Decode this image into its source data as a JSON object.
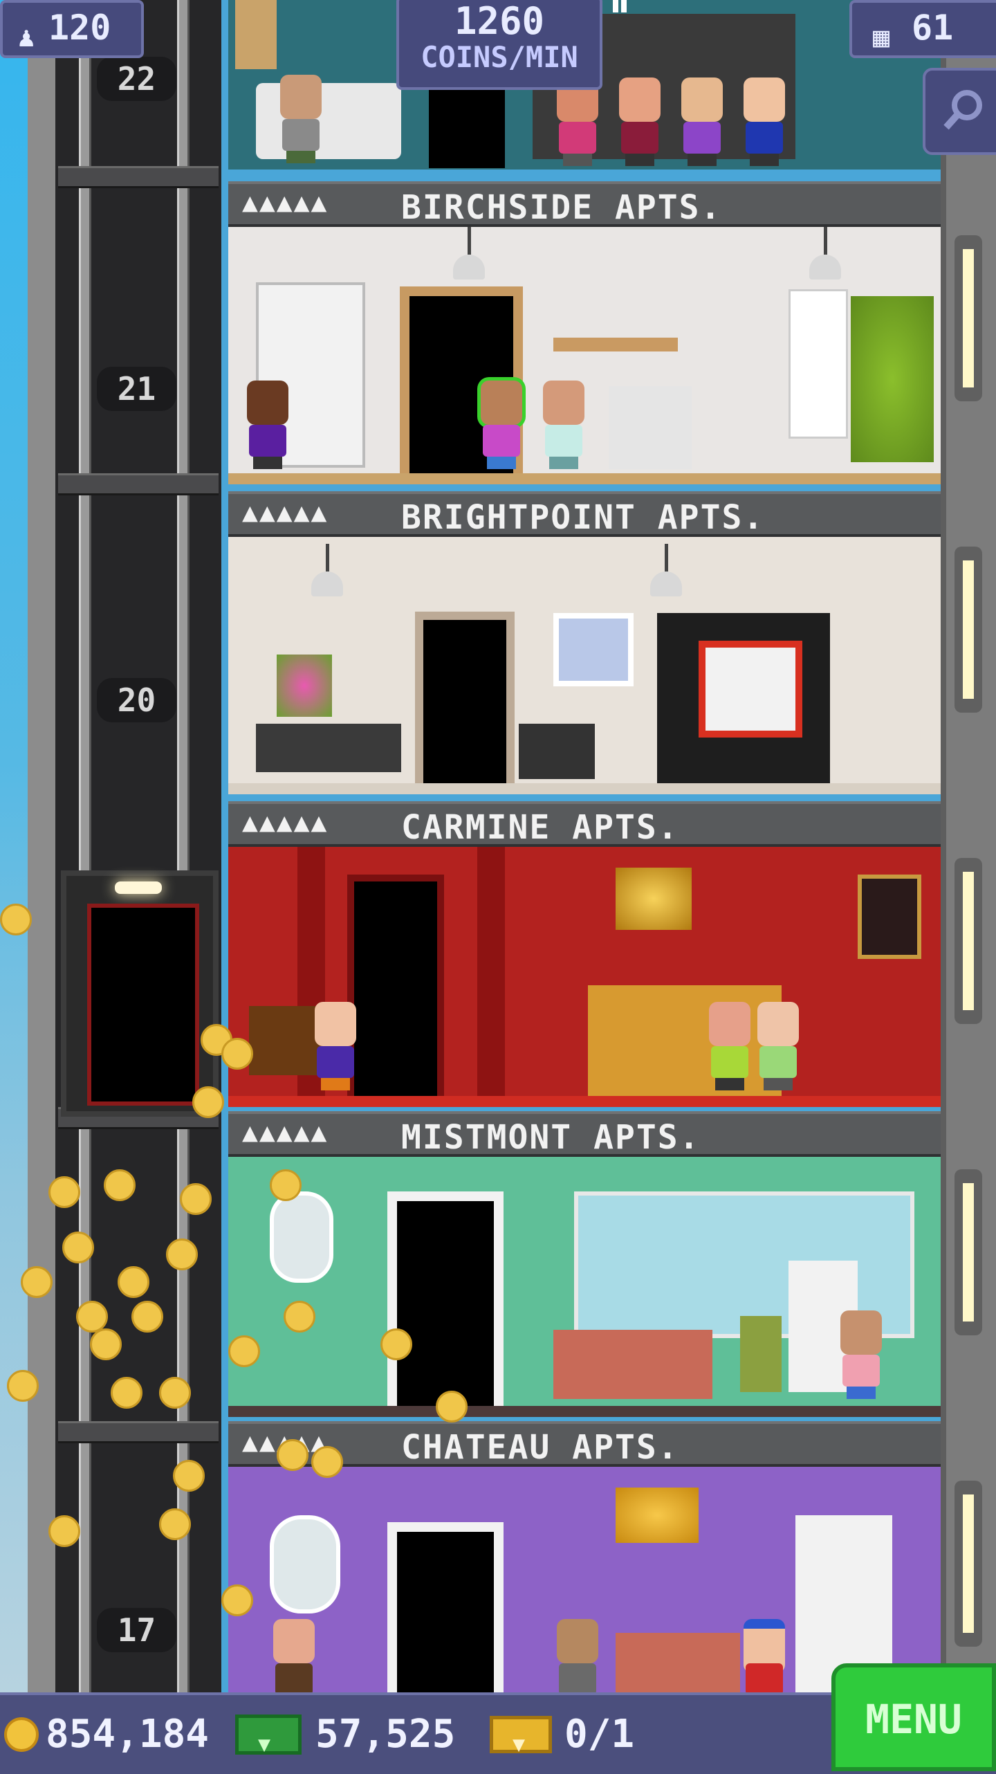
{
  "hud": {
    "population": "120",
    "coins_per_min_value": "1260",
    "coins_per_min_label": "COINS/MIN",
    "floor_count": "61"
  },
  "shaft": {
    "floor_numbers": [
      "22",
      "21",
      "20",
      "17"
    ]
  },
  "floors": [
    {
      "stars": "▲▲▲▲▲",
      "name": "BIRCHSIDE APTS."
    },
    {
      "stars": "▲▲▲▲▲",
      "name": "BRIGHTPOINT APTS."
    },
    {
      "stars": "▲▲▲▲▲",
      "name": "CARMINE APTS."
    },
    {
      "stars": "▲▲▲▲▲",
      "name": "MISTMONT APTS."
    },
    {
      "stars": "▲▲▲▲▲",
      "name": "CHATEAU APTS."
    }
  ],
  "bottom_bar": {
    "coins": "854,184",
    "tower_bux": "57,525",
    "tickets": "0/1",
    "menu_label": "MENU"
  },
  "icons": {
    "population": "person-icon",
    "floors": "building-icon",
    "search": "magnifier-icon",
    "coins": "coin-icon",
    "bux": "tower-bux-icon",
    "tickets": "golden-ticket-icon"
  },
  "colors": {
    "hud_bg": "#464a7c",
    "menu_green": "#2fcb3c",
    "carmine_wall": "#b3221f",
    "mistmont_wall": "#5fbf98",
    "chateau_wall": "#8d62c7"
  }
}
